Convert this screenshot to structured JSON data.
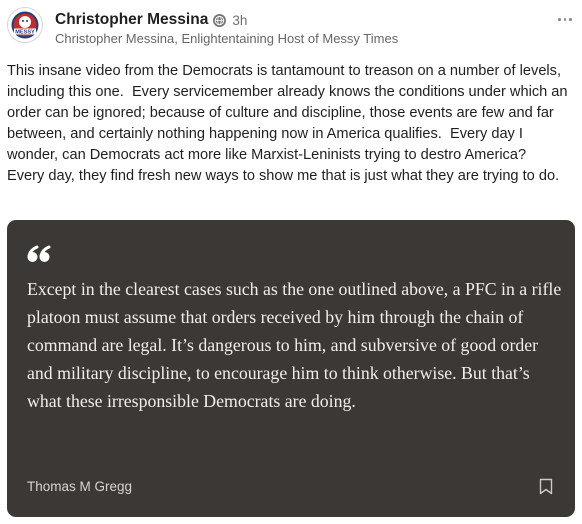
{
  "post": {
    "author_name": "Christopher Messina",
    "time": "3h",
    "subtitle": "Christopher Messina, Enlightentaining Host of Messy Times",
    "avatar_text": "MESSY",
    "text": "This insane video from the Democrats is tantamount to treason on a number of levels, including this one.  Every servicemember already knows the conditions under which an order can be ignored; because of culture and discipline, those events are few and far between, and certainly nothing happening now in America qualifies.  Every day I wonder, can Democrats act more like Marxist-Leninists trying to destro America?  Every day, they find fresh new ways to show me that is just what they are trying to do."
  },
  "quote": {
    "text": "Except in the clearest cases such as the one outlined above, a PFC in a rifle platoon must assume that orders received by him through the chain of command are legal. It’s dangerous to him, and subversive of good order and military discipline, to encourage him to think otherwise. But that’s what these irresponsible Democrats are doing.",
    "author": "Thomas M Gregg"
  },
  "icons": {
    "visibility": "globe-icon",
    "menu": "more-options-icon",
    "quote": "quote-icon",
    "save": "bookmark-icon"
  },
  "colors": {
    "card_background": "#3b3835",
    "quote_text": "#f2efea",
    "meta_text": "#666666"
  }
}
